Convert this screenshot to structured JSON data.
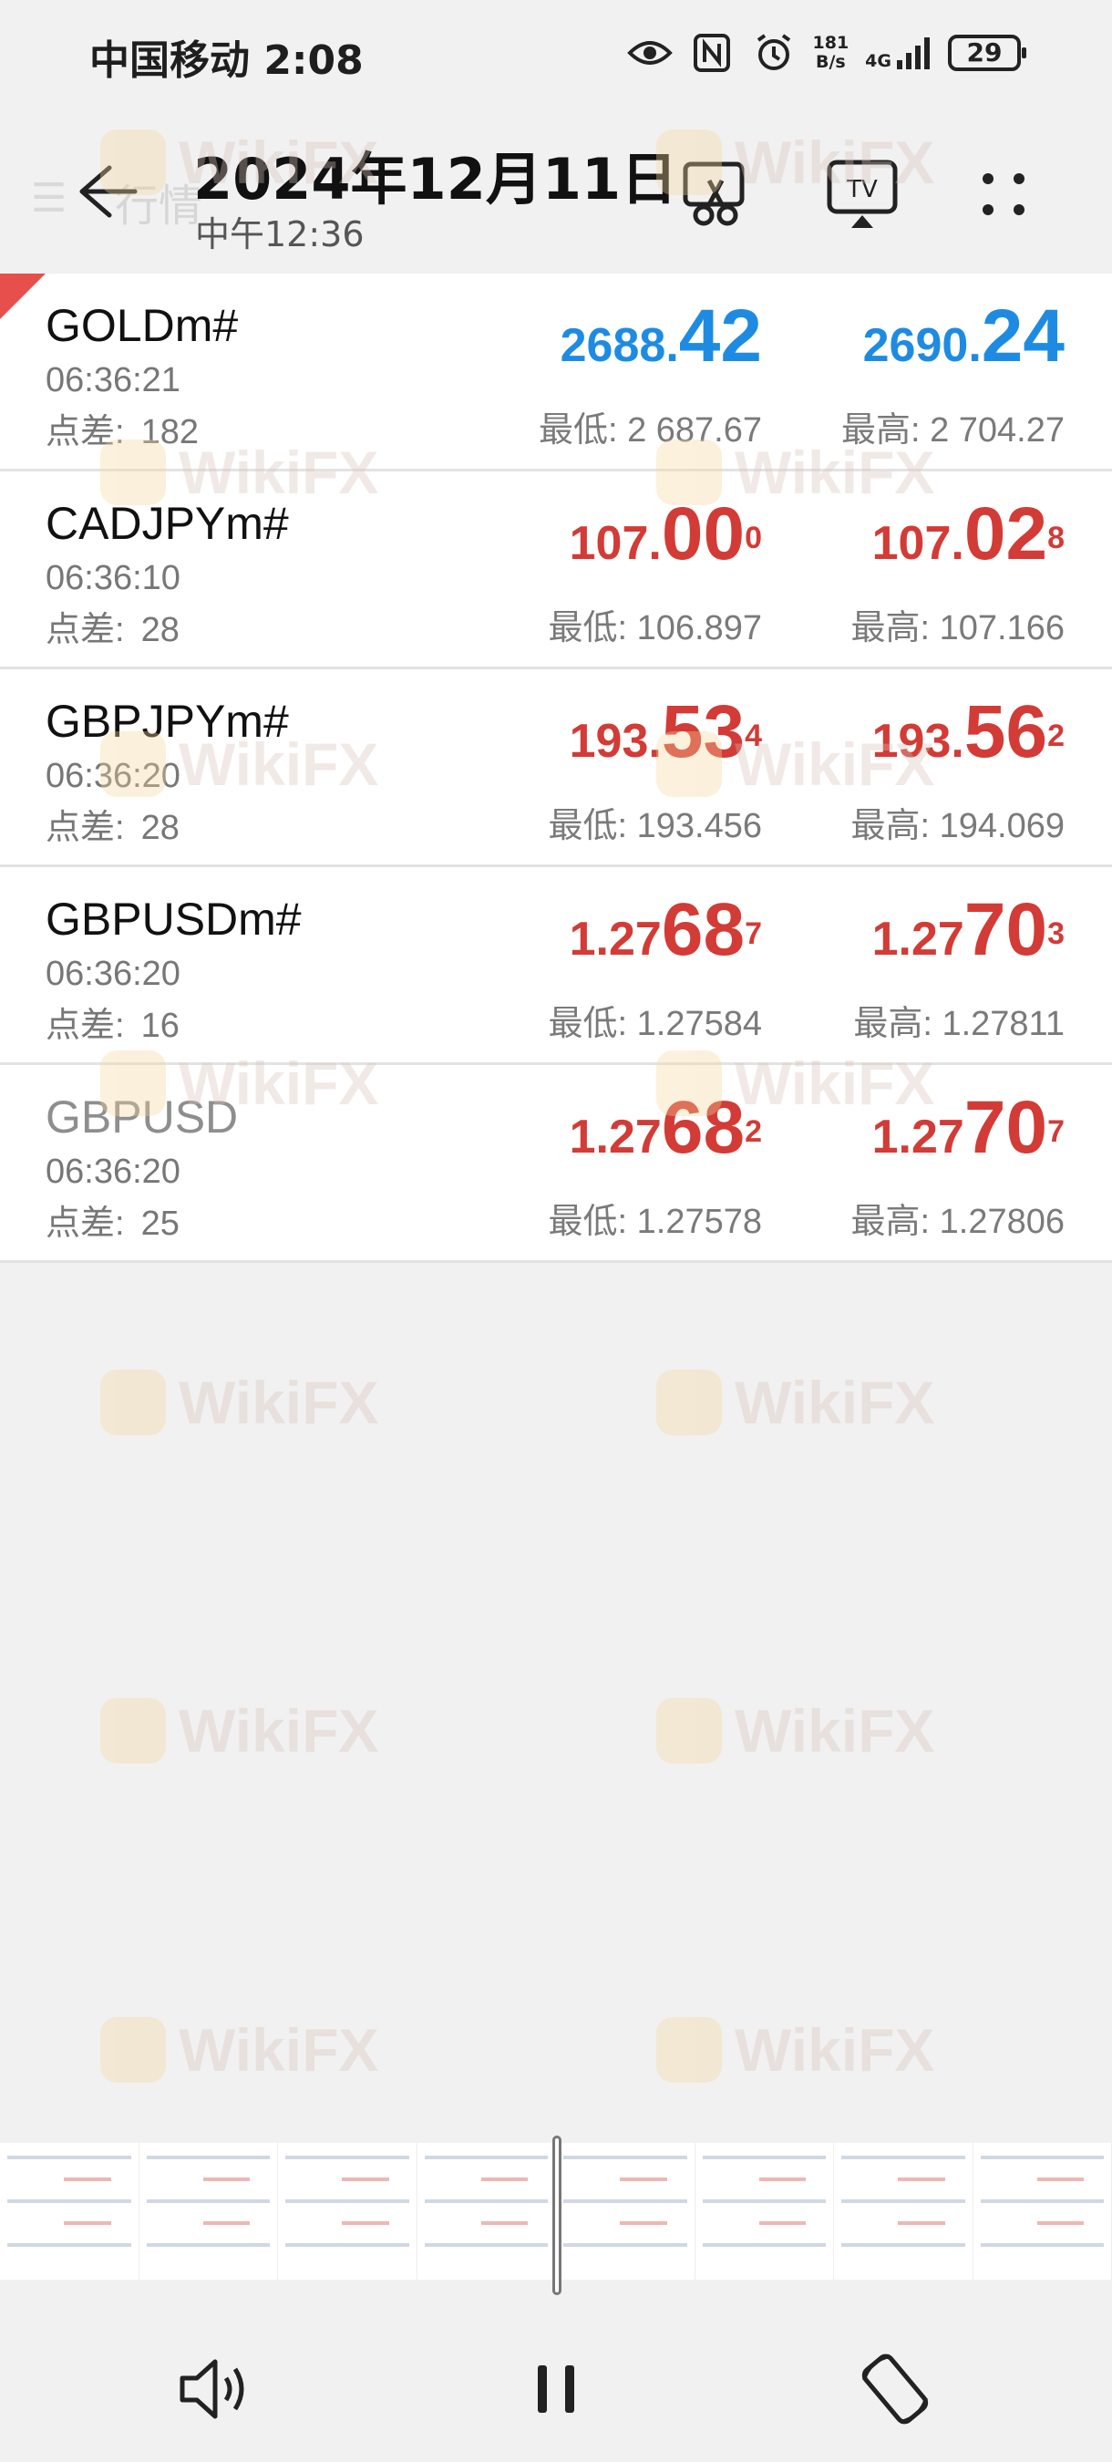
{
  "status_bar": {
    "carrier_time": "中国移动 2:08",
    "net_speed_value": "181",
    "net_speed_unit": "B/s",
    "network_type": "4G",
    "battery": "29"
  },
  "header": {
    "date": "2024年12月11日",
    "time": "中午12:36",
    "ghost_title": "行情"
  },
  "quotes": [
    {
      "symbol": "GOLDm#",
      "time": "06:36:21",
      "spread_label": "点差:",
      "spread": "182",
      "bid": {
        "small": "2688.",
        "big": "42",
        "sup": ""
      },
      "ask": {
        "small": "2690.",
        "big": "24",
        "sup": ""
      },
      "low": "最低: 2 687.67",
      "high": "最高: 2 704.27",
      "price_color": "#1e8be3"
    },
    {
      "symbol": "CADJPYm#",
      "time": "06:36:10",
      "spread_label": "点差:",
      "spread": "28",
      "bid": {
        "small": "107.",
        "big": "00",
        "sup": "0"
      },
      "ask": {
        "small": "107.",
        "big": "02",
        "sup": "8"
      },
      "low": "最低: 106.897",
      "high": "最高: 107.166",
      "price_color": "#d33b36"
    },
    {
      "symbol": "GBPJPYm#",
      "time": "06:36:20",
      "spread_label": "点差:",
      "spread": "28",
      "bid": {
        "small": "193.",
        "big": "53",
        "sup": "4"
      },
      "ask": {
        "small": "193.",
        "big": "56",
        "sup": "2"
      },
      "low": "最低: 193.456",
      "high": "最高: 194.069",
      "price_color": "#d33b36"
    },
    {
      "symbol": "GBPUSDm#",
      "time": "06:36:20",
      "spread_label": "点差:",
      "spread": "16",
      "bid": {
        "small": "1.27",
        "big": "68",
        "sup": "7"
      },
      "ask": {
        "small": "1.27",
        "big": "70",
        "sup": "3"
      },
      "low": "最低: 1.27584",
      "high": "最高: 1.27811",
      "price_color": "#d33b36"
    },
    {
      "symbol": "GBPUSD",
      "time": "06:36:20",
      "spread_label": "点差:",
      "spread": "25",
      "bid": {
        "small": "1.27",
        "big": "68",
        "sup": "2"
      },
      "ask": {
        "small": "1.27",
        "big": "70",
        "sup": "7"
      },
      "low": "最低: 1.27578",
      "high": "最高: 1.27806",
      "price_color": "#d33b36"
    }
  ],
  "watermark": "WikiFX",
  "icons": {
    "back": "back-arrow-icon",
    "screenshot": "scissors-icon",
    "cast": "tv-cast-icon",
    "more": "more-dots-icon",
    "volume": "volume-icon",
    "pause": "pause-icon",
    "rotate": "rotate-icon"
  }
}
